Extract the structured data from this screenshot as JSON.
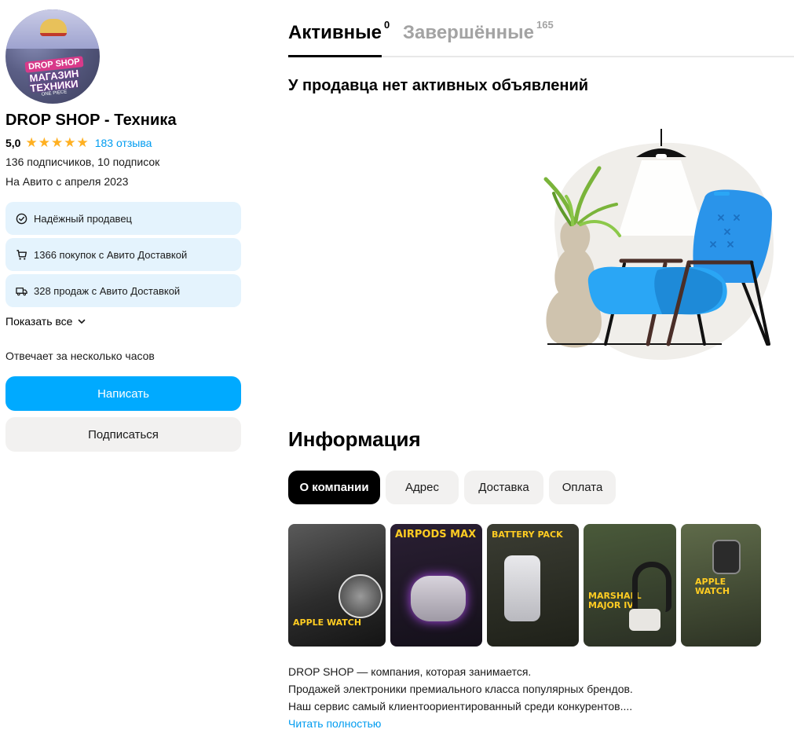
{
  "seller": {
    "avatar_text": [
      "DROP SHOP",
      "МАГАЗИН",
      "ТЕХНИКИ",
      "ONE PIECE"
    ],
    "name": "DROP SHOP - Техника",
    "rating": "5,0",
    "stars": 5,
    "reviews": "183 отзыва",
    "followers": "136 подписчиков, 10 подписок",
    "since": "На Авито с апреля 2023"
  },
  "badges": [
    {
      "icon": "check-circle-icon",
      "label": "Надёжный продавец"
    },
    {
      "icon": "cart-icon",
      "label": "1366 покупок с Авито Доставкой"
    },
    {
      "icon": "truck-icon",
      "label": "328 продаж с Авито Доставкой"
    }
  ],
  "show_all": "Показать все",
  "response_time": "Отвечает за несколько часов",
  "buttons": {
    "write": "Написать",
    "subscribe": "Подписаться"
  },
  "tabs": [
    {
      "label": "Активные",
      "count": "0",
      "active": true
    },
    {
      "label": "Завершённые",
      "count": "165",
      "active": false
    }
  ],
  "empty_message": "У продавца нет активных объявлений",
  "info": {
    "title": "Информация",
    "chips": [
      {
        "label": "О компании",
        "active": true
      },
      {
        "label": "Адрес",
        "active": false
      },
      {
        "label": "Доставка",
        "active": false
      },
      {
        "label": "Оплата",
        "active": false
      }
    ],
    "gallery": [
      {
        "caption": "APPLE WATCH"
      },
      {
        "caption": "AIRPODS MAX"
      },
      {
        "caption": "BATTERY PACK"
      },
      {
        "caption": "MARSHALL MAJOR IV"
      },
      {
        "caption": "APPLE WATCH"
      }
    ],
    "description": [
      "DROP SHOP — компания, которая занимается.",
      "Продажей электроники премиального класса популярных брендов.",
      "Наш сервис самый клиентоориентированный среди конкурентов...."
    ],
    "read_more": "Читать полностью"
  },
  "colors": {
    "accent": "#00aaff",
    "link": "#009cf0",
    "star": "#ffb021",
    "badge_bg": "#e4f3fd",
    "chair": "#2aa6f5"
  }
}
